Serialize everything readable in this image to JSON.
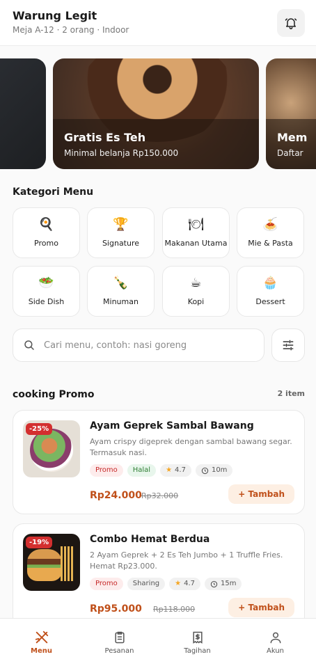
{
  "header": {
    "title": "Warung Legit",
    "subtitle": "Meja A-12 · 2 orang · Indoor"
  },
  "banners": [
    {
      "title": "",
      "subtitle": ""
    },
    {
      "title": "Gratis Es Teh",
      "subtitle": "Minimal belanja Rp150.000"
    },
    {
      "title": "Mem",
      "subtitle": "Daftar"
    }
  ],
  "categories_title": "Kategori Menu",
  "categories": [
    {
      "label": "Promo",
      "icon": "🍳"
    },
    {
      "label": "Signature",
      "icon": "🏆"
    },
    {
      "label": "Makanan Utama",
      "icon": "🍽"
    },
    {
      "label": "Mie & Pasta",
      "icon": "🍝"
    },
    {
      "label": "Side Dish",
      "icon": "🥗"
    },
    {
      "label": "Minuman",
      "icon": "🍾"
    },
    {
      "label": "Kopi",
      "icon": "☕"
    },
    {
      "label": "Dessert",
      "icon": "🧁"
    }
  ],
  "search": {
    "placeholder": "Cari menu, contoh: nasi goreng",
    "value": ""
  },
  "section": {
    "title": "cooking Promo",
    "count": "2 item"
  },
  "items": [
    {
      "discount": "-25%",
      "name": "Ayam Geprek Sambal Bawang",
      "description": "Ayam crispy digeprek dengan sambal bawang segar. Termasuk nasi.",
      "tags": [
        "Promo",
        "Halal"
      ],
      "rating": "4.7",
      "time": "10m",
      "price": "Rp24.000",
      "old_price": "Rp32.000",
      "add_label": "+ Tambah"
    },
    {
      "discount": "-19%",
      "name": "Combo Hemat Berdua",
      "description": "2 Ayam Geprek + 2 Es Teh Jumbo + 1 Truffle Fries. Hemat Rp23.000.",
      "tags": [
        "Promo",
        "Sharing"
      ],
      "rating": "4.7",
      "time": "15m",
      "price": "Rp95.000",
      "old_price": "Rp118.000",
      "add_label": "+ Tambah"
    }
  ],
  "nav": [
    {
      "label": "Menu",
      "icon": "fork-knife-icon",
      "active": true
    },
    {
      "label": "Pesanan",
      "icon": "clipboard-icon",
      "active": false
    },
    {
      "label": "Tagihan",
      "icon": "receipt-icon",
      "active": false
    },
    {
      "label": "Akun",
      "icon": "user-icon",
      "active": false
    }
  ],
  "colors": {
    "accent": "#c0501a",
    "promo": "#c62828",
    "halal": "#2e7d32"
  }
}
